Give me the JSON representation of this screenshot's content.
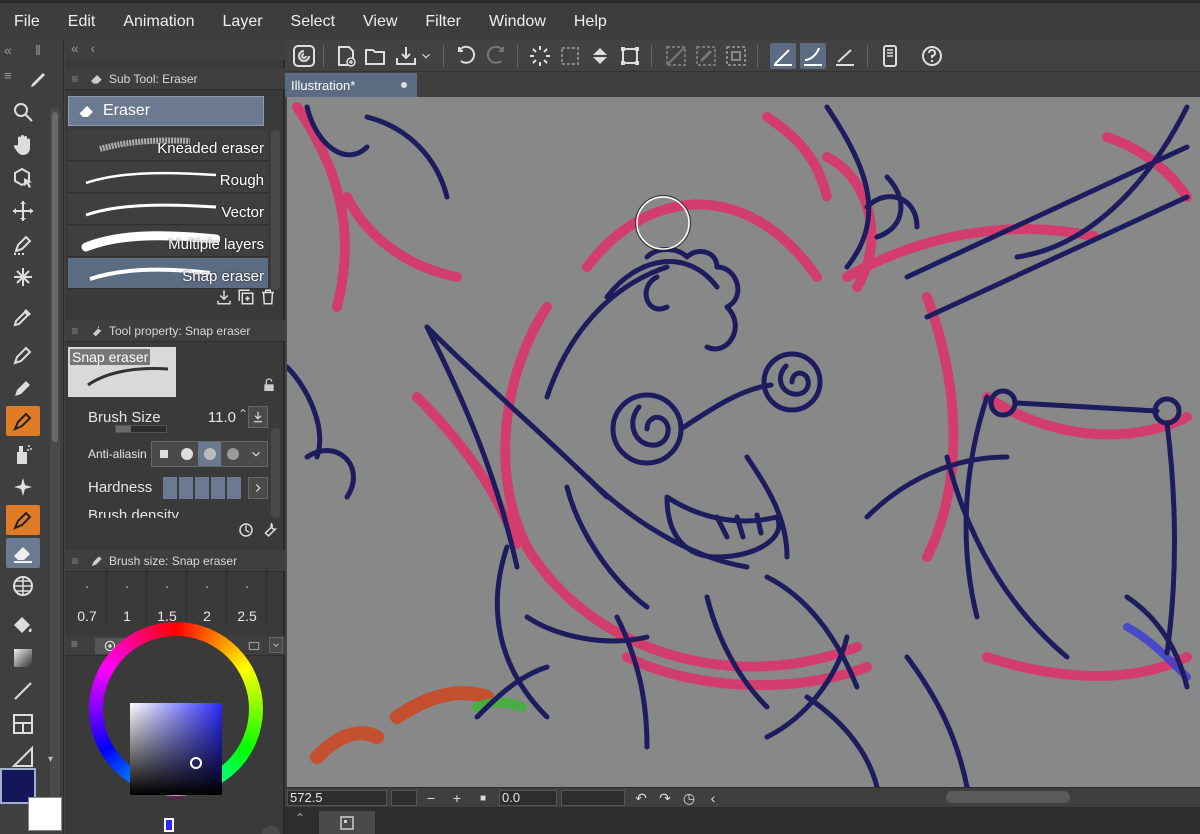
{
  "menu": [
    "File",
    "Edit",
    "Animation",
    "Layer",
    "Select",
    "View",
    "Filter",
    "Window",
    "Help"
  ],
  "sub_tool": {
    "title": "Sub Tool: Eraser",
    "group": "Eraser",
    "items": [
      "Kneaded eraser",
      "Rough",
      "Vector",
      "Multiple layers",
      "Snap eraser"
    ],
    "selected": "Snap eraser"
  },
  "tool_property": {
    "title": "Tool property: Snap eraser",
    "preview_label": "Snap eraser",
    "brush_size_label": "Brush Size",
    "brush_size_value": "11.0",
    "anti_aliasing_label": "Anti-aliasin",
    "hardness_label": "Hardness",
    "brush_density_label": "Brush density"
  },
  "brush_size_palette": {
    "title": "Brush size: Snap eraser",
    "sizes": [
      "0.7",
      "1",
      "1.5",
      "2",
      "2.5"
    ]
  },
  "canvas": {
    "tab_title": "Illustration*",
    "zoom": "572.5",
    "rotation": "0.0"
  },
  "colors": {
    "main": "#15155a",
    "sub": "#ffffff",
    "accent_selected": "#6b7a90",
    "tool_orange": "#e07b26",
    "sketch_red": "#e0306a",
    "line_navy": "#1c1c5e"
  }
}
